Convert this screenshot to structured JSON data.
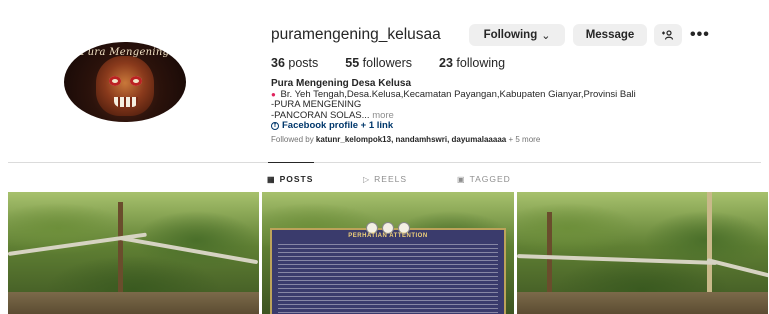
{
  "profile": {
    "username": "puramengening_kelusaa",
    "avatar_text": "Pura Mengening",
    "actions": {
      "following_label": "Following",
      "message_label": "Message",
      "add_user_icon": "add-user-icon",
      "more_icon": "more-icon"
    },
    "stats": {
      "posts_count": "36",
      "posts_label": "posts",
      "followers_count": "55",
      "followers_label": "followers",
      "following_count": "23",
      "following_label": "following"
    },
    "bio": {
      "name": "Pura Mengening Desa Kelusa",
      "location": "Br. Yeh Tengah,Desa.Kelusa,Kecamatan Payangan,Kabupaten Gianyar,Provinsi Bali",
      "line1": "-PURA MENGENING",
      "line2": "-PANCORAN SOLAS...",
      "more": "more",
      "link": "Facebook profile + 1 link"
    },
    "followed_by": {
      "prefix": "Followed by",
      "users": "katunr_kelompok13, nandamhswri, dayumalaaaaa",
      "suffix": "+ 5 more"
    }
  },
  "tabs": [
    {
      "label": "POSTS",
      "icon": "grid-icon",
      "active": true
    },
    {
      "label": "REELS",
      "icon": "reels-icon",
      "active": false
    },
    {
      "label": "TAGGED",
      "icon": "tagged-icon",
      "active": false
    }
  ],
  "posts": {
    "board_title": "PERHATIAN ATTENTION"
  },
  "colors": {
    "link": "#00376b",
    "button_bg": "#efefef",
    "muted": "#8e8e8e"
  }
}
